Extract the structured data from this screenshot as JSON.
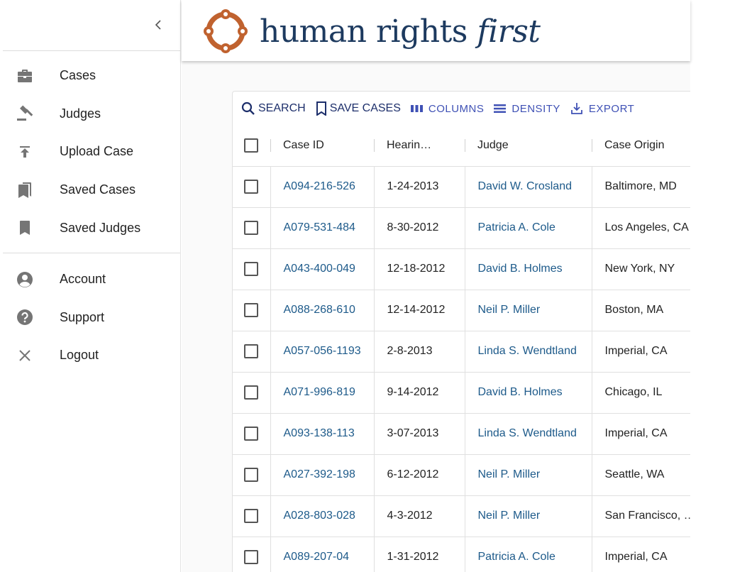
{
  "sidebar": {
    "collapse_label": "‹",
    "primary_items": [
      {
        "label": "Cases",
        "icon": "briefcase-icon"
      },
      {
        "label": "Judges",
        "icon": "gavel-icon"
      },
      {
        "label": "Upload Case",
        "icon": "upload-icon"
      },
      {
        "label": "Saved Cases",
        "icon": "bookmarks-icon"
      },
      {
        "label": "Saved Judges",
        "icon": "bookmark-icon"
      }
    ],
    "secondary_items": [
      {
        "label": "Account",
        "icon": "account-circle-icon"
      },
      {
        "label": "Support",
        "icon": "help-icon"
      },
      {
        "label": "Logout",
        "icon": "close-icon"
      }
    ]
  },
  "header": {
    "logo_text_regular": "human rights ",
    "logo_text_italic": "first",
    "logo_color": "#1d3a5f",
    "logo_ring_color": "#c0622f"
  },
  "toolbar": {
    "search_label": "SEARCH",
    "save_cases_label": "SAVE CASES",
    "columns_label": "COLUMNS",
    "density_label": "DENSITY",
    "export_label": "EXPORT"
  },
  "table": {
    "columns": [
      "Case ID",
      "Hearin…",
      "Judge",
      "Case Origin"
    ],
    "rows": [
      {
        "case_id": "A094-216-526",
        "date": "1-24-2013",
        "judge": "David W. Crosland",
        "origin": "Baltimore, MD"
      },
      {
        "case_id": "A079-531-484",
        "date": "8-30-2012",
        "judge": "Patricia A. Cole",
        "origin": "Los Angeles, CA"
      },
      {
        "case_id": "A043-400-049",
        "date": "12-18-2012",
        "judge": "David B. Holmes",
        "origin": "New York, NY"
      },
      {
        "case_id": "A088-268-610",
        "date": "12-14-2012",
        "judge": "Neil P. Miller",
        "origin": "Boston, MA"
      },
      {
        "case_id": "A057-056-1193",
        "date": "2-8-2013",
        "judge": "Linda S. Wendtland",
        "origin": "Imperial, CA"
      },
      {
        "case_id": "A071-996-819",
        "date": "9-14-2012",
        "judge": "David B. Holmes",
        "origin": "Chicago, IL"
      },
      {
        "case_id": "A093-138-113",
        "date": "3-07-2013",
        "judge": "Linda S. Wendtland",
        "origin": "Imperial, CA"
      },
      {
        "case_id": "A027-392-198",
        "date": "6-12-2012",
        "judge": "Neil P. Miller",
        "origin": "Seattle, WA"
      },
      {
        "case_id": "A028-803-028",
        "date": "4-3-2012",
        "judge": "Neil P. Miller",
        "origin": "San Francisco, …"
      },
      {
        "case_id": "A089-207-04",
        "date": "1-31-2012",
        "judge": "Patricia A. Cole",
        "origin": "Imperial, CA"
      }
    ]
  },
  "colors": {
    "link": "#1d5a8a",
    "toolbar_primary": "#1d2f6b",
    "toolbar_secondary": "#3f51b5",
    "icon_gray": "#757575"
  }
}
